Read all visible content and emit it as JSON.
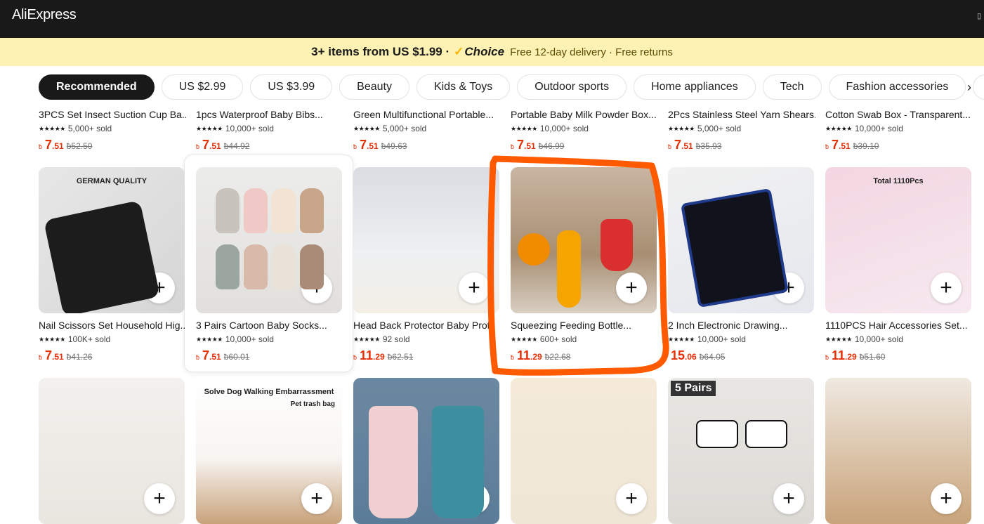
{
  "header": {
    "logo": "AliExpress",
    "qr_glyph": "▯"
  },
  "promo": {
    "strong": "3+ items from US $1.99 ·",
    "choice": "Choice",
    "sub": "Free 12-day delivery · Free returns"
  },
  "chips": [
    {
      "label": "Recommended",
      "active": true
    },
    {
      "label": "US $2.99"
    },
    {
      "label": "US $3.99"
    },
    {
      "label": "Beauty"
    },
    {
      "label": "Kids & Toys"
    },
    {
      "label": "Outdoor sports"
    },
    {
      "label": "Home appliances"
    },
    {
      "label": "Tech"
    },
    {
      "label": "Fashion accessories"
    }
  ],
  "chip_next": "›",
  "plus_glyph": "+",
  "row0": [
    {
      "title": "3PCS Set Insect Suction Cup Ba...",
      "rating": "5,000+ sold",
      "cur": "ƀ",
      "int": "7",
      "dec": ".51",
      "old": "ƀ52.50"
    },
    {
      "title": "1pcs Waterproof Baby Bibs...",
      "rating": "10,000+ sold",
      "cur": "ƀ",
      "int": "7",
      "dec": ".51",
      "old": "ƀ44.92"
    },
    {
      "title": "Green Multifunctional Portable...",
      "rating": "5,000+ sold",
      "cur": "ƀ",
      "int": "7",
      "dec": ".51",
      "old": "ƀ49.63"
    },
    {
      "title": "Portable Baby Milk Powder Box...",
      "rating": "10,000+ sold",
      "cur": "ƀ",
      "int": "7",
      "dec": ".51",
      "old": "ƀ46.99"
    },
    {
      "title": "2Pcs Stainless Steel Yarn Shears...",
      "rating": "5,000+ sold",
      "cur": "ƀ",
      "int": "7",
      "dec": ".51",
      "old": "ƀ35.93"
    },
    {
      "title": "Cotton Swab Box - Transparent...",
      "rating": "10,000+ sold",
      "cur": "ƀ",
      "int": "7",
      "dec": ".51",
      "old": "ƀ39.10"
    }
  ],
  "row1": [
    {
      "title": "Nail Scissors Set Household Hig...",
      "rating": "100K+ sold",
      "cur": "ƀ",
      "int": "7",
      "dec": ".51",
      "old": "ƀ41.26",
      "img_text": "GERMAN QUALITY"
    },
    {
      "title": "3 Pairs Cartoon Baby Socks...",
      "rating": "10,000+ sold",
      "cur": "ƀ",
      "int": "7",
      "dec": ".51",
      "old": "ƀ60.01"
    },
    {
      "title": "Head Back Protector Baby Prot",
      "rating": "92 sold",
      "cur": "ƀ",
      "int": "11",
      "dec": ".29",
      "old": "ƀ62.51"
    },
    {
      "title": "Squeezing Feeding Bottle...",
      "rating": "600+ sold",
      "cur": "ƀ",
      "int": "11",
      "dec": ".29",
      "old": "ƀ22.68"
    },
    {
      "title": "2 Inch Electronic Drawing...",
      "rating": "10,000+ sold",
      "cur": "",
      "int": "15",
      "dec": ".06",
      "old": "ƀ64.05"
    },
    {
      "title": "1110PCS Hair Accessories Set...",
      "rating": "10,000+ sold",
      "cur": "ƀ",
      "int": "11",
      "dec": ".29",
      "old": "ƀ51.60",
      "img_text": "Total 1110Pcs"
    }
  ],
  "row2": [
    {
      "title": ""
    },
    {
      "title": "",
      "img_text": "Solve Dog Walking Embarrassment",
      "img_text2": "Pet trash bag"
    },
    {
      "title": ""
    },
    {
      "title": ""
    },
    {
      "title": "",
      "img_text": "5 Pairs"
    },
    {
      "title": ""
    }
  ],
  "colors": {
    "accent": "#e62e04",
    "annotation": "#ff5a00",
    "promo_bg": "#fdf2b4"
  }
}
